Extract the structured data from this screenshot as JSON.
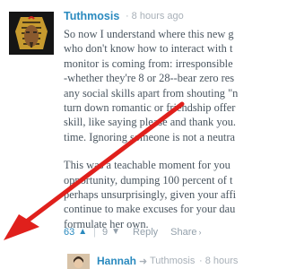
{
  "comment": {
    "author": "Tuthmosis",
    "timestamp": "8 hours ago",
    "paragraphs": [
      [
        "So now I understand where this new g",
        "who don't know how to interact with t",
        "monitor is coming from: irresponsible",
        "-whether they're 8 or 28--bear zero res",
        "any social skills apart from shouting \"n",
        "turn down romantic or friendship offer",
        "skill, like saying please and thank you.",
        "time. Ignoring someone is not a neutra"
      ],
      [
        "This was a teachable moment for you",
        "opportunity, dumping 100 percent of t",
        "perhaps unsurprisingly, given your affi",
        "continue to make excuses for your dau",
        "formulate her own."
      ]
    ],
    "upvotes": "63",
    "downvotes": "9",
    "reply_label": "Reply",
    "share_label": "Share"
  },
  "reply": {
    "author": "Hannah",
    "to": "Tuthmosis",
    "timestamp": "8 hours ago"
  },
  "colors": {
    "link_blue": "#2a8abf",
    "annotation_red": "#e0201c"
  }
}
